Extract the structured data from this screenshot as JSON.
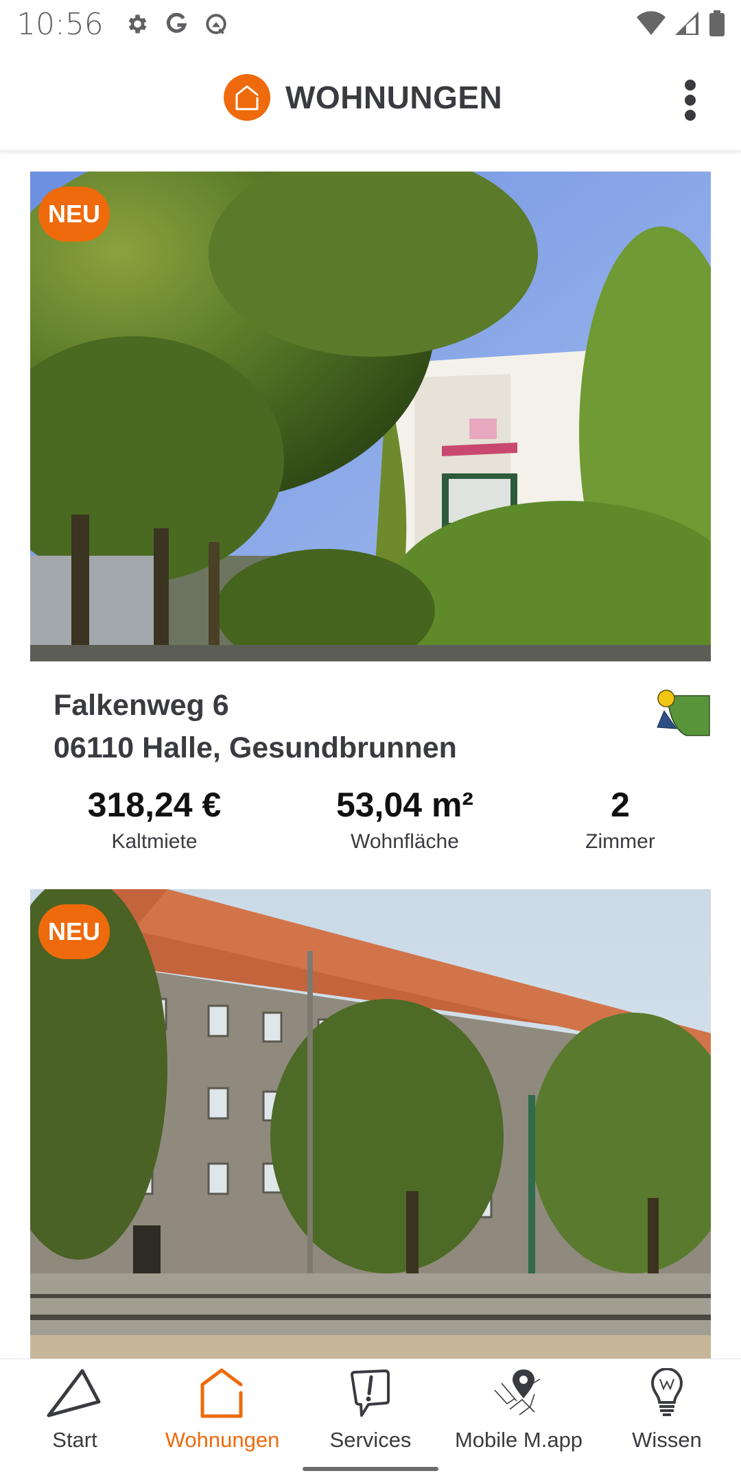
{
  "status_bar": {
    "time": "10:56",
    "left_icons": [
      "gear-icon",
      "google-icon",
      "q-beta-icon"
    ],
    "right_icons": [
      "wifi-icon",
      "cell-signal-icon",
      "battery-icon"
    ]
  },
  "app_bar": {
    "logo_icon": "house-icon",
    "title": "WOHNUNGEN",
    "menu_icon": "more-vertical-icon"
  },
  "colors": {
    "accent": "#ee6a0c",
    "text": "#3a3b40"
  },
  "listings": [
    {
      "badge": "NEU",
      "photo": "green trees and white building with balconies",
      "address_line1": "Falkenweg 6",
      "address_line2": "06110 Halle, Gesundbrunnen",
      "provider_logo": "provider-logo",
      "stats": [
        {
          "value": "318,24 €",
          "label": "Kaltmiete"
        },
        {
          "value": "53,04 m²",
          "label": "Wohnfläche"
        },
        {
          "value": "2",
          "label": "Zimmer"
        }
      ]
    },
    {
      "badge": "NEU",
      "photo": "grey apartment block with red tiled roof and tram tracks"
    }
  ],
  "bottom_nav": {
    "items": [
      {
        "label": "Start",
        "icon": "triangle-icon",
        "active": false
      },
      {
        "label": "Wohnungen",
        "icon": "house-icon",
        "active": true
      },
      {
        "label": "Services",
        "icon": "speech-bubble-exclamation-icon",
        "active": false
      },
      {
        "label": "Mobile M.app",
        "icon": "map-pin-icon",
        "active": false
      },
      {
        "label": "Wissen",
        "icon": "lightbulb-icon",
        "active": false
      }
    ]
  }
}
